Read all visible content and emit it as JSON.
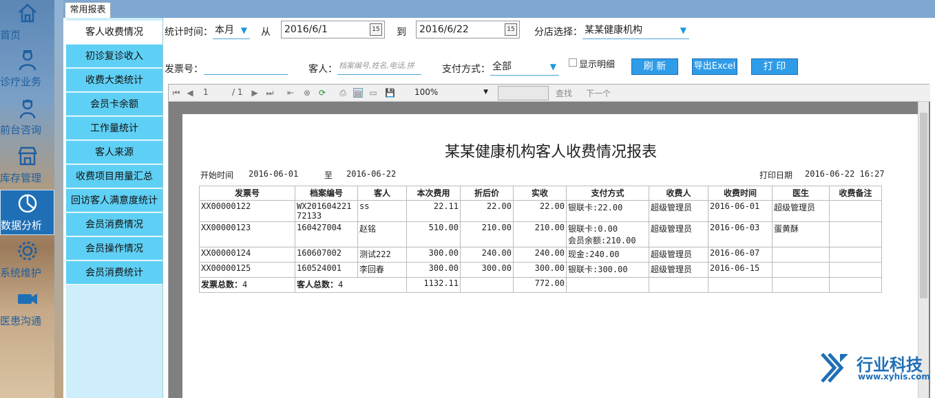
{
  "nav": {
    "items": [
      {
        "label": "首页",
        "icon": "home-icon"
      },
      {
        "label": "诊疗业务",
        "icon": "doctor-icon"
      },
      {
        "label": "前台咨询",
        "icon": "nurse-icon"
      },
      {
        "label": "库存管理",
        "icon": "store-icon"
      },
      {
        "label": "数据分析",
        "icon": "pie-chart-icon",
        "active": true
      },
      {
        "label": "系统维护",
        "icon": "gear-icon"
      },
      {
        "label": "医患沟通",
        "icon": "video-camera-icon"
      }
    ]
  },
  "tab": {
    "label": "常用报表"
  },
  "submenu": {
    "items": [
      "客人收费情况",
      "初诊复诊收入",
      "收费大类统计",
      "会员卡余额",
      "工作量统计",
      "客人来源",
      "收费项目用量汇总",
      "回访客人满意度统计",
      "会员消费情况",
      "会员操作情况",
      "会员消费统计"
    ],
    "active": "客人收费情况"
  },
  "filters": {
    "period_label": "统计时间：",
    "period_value": "本月",
    "from_label": "从",
    "from_date": "2016/6/1",
    "to_label": "到",
    "to_date": "2016/6/22",
    "branch_label": "分店选择：",
    "branch_value": "某某健康机构",
    "invoice_label": "发票号：",
    "invoice_value": "",
    "customer_label": "客人：",
    "customer_placeholder": "档案编号,姓名,电话,拼",
    "payment_label": "支付方式：",
    "payment_value": "全部",
    "show_detail_label": "显示明细",
    "calendar_label": "15"
  },
  "buttons": {
    "refresh": "刷 新",
    "export": "导出Excel",
    "print": "打 印"
  },
  "viewer": {
    "page_current": "1",
    "page_total": "/ 1",
    "zoom": "100%",
    "search_value": "",
    "find_label": "查找",
    "next_label": "下一个"
  },
  "report": {
    "title": "某某健康机构客人收费情况报表",
    "start_label": "开始时间",
    "start_value": "2016-06-01",
    "to_label": "至",
    "end_value": "2016-06-22",
    "print_label": "打印日期",
    "print_value": "2016-06-22 16:27",
    "columns": [
      "发票号",
      "档案编号",
      "客人",
      "本次费用",
      "折后价",
      "实收",
      "支付方式",
      "收费人",
      "收费时间",
      "医生",
      "收费备注"
    ],
    "rows": [
      [
        "XX00000122",
        "WX20160422172133",
        "ss",
        "22.11",
        "22.00",
        "22.00",
        "银联卡:22.00",
        "超级管理员",
        "2016-06-01",
        "超级管理员",
        ""
      ],
      [
        "XX00000123",
        "160427004",
        "赵铭",
        "510.00",
        "210.00",
        "210.00",
        "银联卡:0.00\n会员余额:210.00",
        "超级管理员",
        "2016-06-03",
        "蛋黄酥",
        ""
      ],
      [
        "XX00000124",
        "160607002",
        "测试222",
        "300.00",
        "240.00",
        "240.00",
        "现金:240.00",
        "超级管理员",
        "2016-06-07",
        "",
        ""
      ],
      [
        "XX00000125",
        "160524001",
        "李回春",
        "300.00",
        "300.00",
        "300.00",
        "银联卡:300.00",
        "超级管理员",
        "2016-06-15",
        "",
        ""
      ]
    ],
    "totals": {
      "invoice_label": "发票总数：",
      "invoice_count": "4",
      "customer_label": "客人总数：",
      "customer_count": "4",
      "fee_total": "1132.11",
      "received_total": "772.00"
    }
  },
  "logo": {
    "name": "行业科技",
    "url": "www.xyhis.com"
  },
  "colors": {
    "accent": "#2f9ce8",
    "submenu": "#5fd0f5",
    "nav_active": "#1f6fb6"
  }
}
